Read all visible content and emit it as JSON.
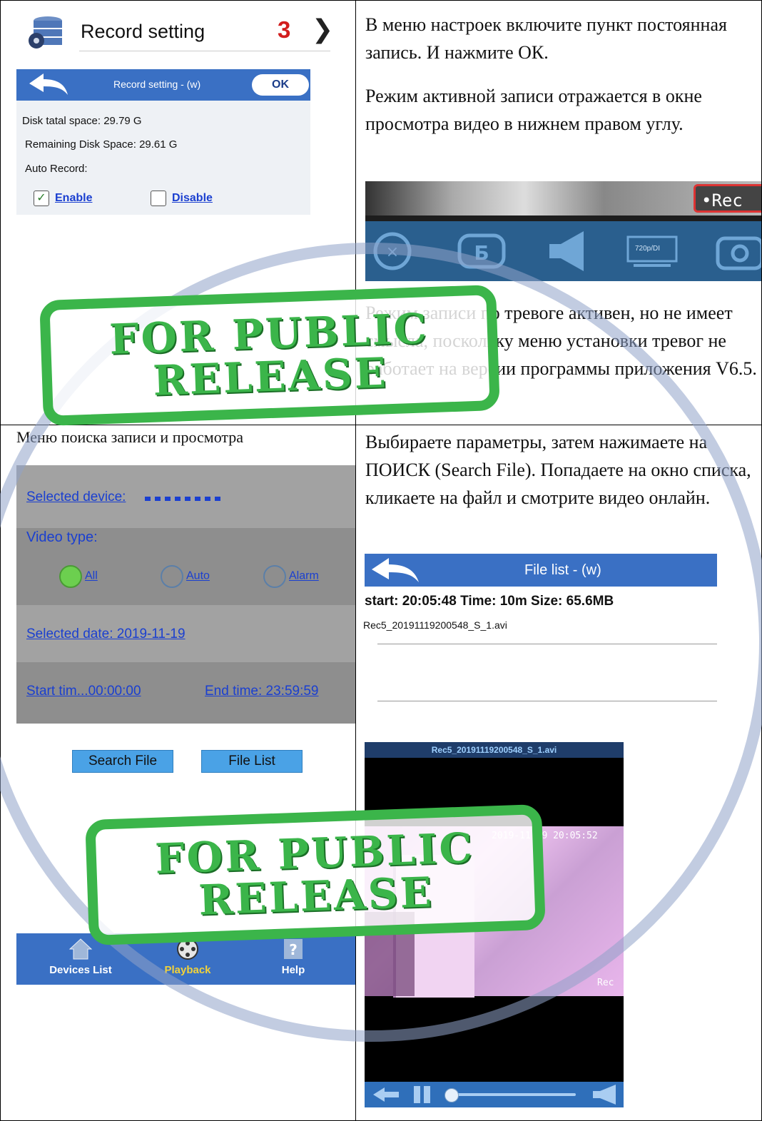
{
  "top_left": {
    "header_title": "Record setting",
    "header_badge": "3",
    "app_bar_title": "Record setting - (w)",
    "ok_label": "OK",
    "disk_total": "Disk  tatal space:  29.79 G",
    "disk_remaining": "Remaining Disk Space:  29.61 G",
    "auto_record": "Auto Record:",
    "enable_label": "Enable",
    "disable_label": "Disable"
  },
  "top_right": {
    "para1": "В меню настроек включите пункт постоянная запись. И нажмите ОК.",
    "para2": "Режим активной записи отражается в окне просмотра видео в нижнем правом углу.",
    "rec_badge": "•Rec",
    "quality_label": "720p/DI",
    "para3": "Режим записи по тревоге активен, но не имеет смысла, поскольку меню установки тревог не работает на версии программы приложения V6.5."
  },
  "bottom_left": {
    "heading": "Меню поиска записи и просмотра",
    "selected_device": "Selected device:  ",
    "video_type": "Video type:",
    "radio_all": "All",
    "radio_auto": "Auto",
    "radio_alarm": "Alarm",
    "selected_date": "Selected date:  2019-11-19",
    "start_time": "Start tim...00:00:00",
    "end_time": "End time:  23:59:59",
    "search_btn": "Search File",
    "filelist_btn": "File List",
    "tab_devices": "Devices List",
    "tab_playback": "Playback",
    "tab_help": "Help"
  },
  "bottom_right": {
    "para": "Выбираете параметры, затем нажимаете на ПОИСК (Search File). Попадаете на окно списка, кликаете на файл и смотрите видео онлайн.",
    "filelist_title": "File list - (w)",
    "file_meta": "start: 20:05:48  Time:  10m  Size:  65.6MB",
    "file_name": "Rec5_20191119200548_S_1.avi",
    "player_title": "Rec5_20191119200548_S_1.avi",
    "video_timestamp": "2019-11-19 20:05:52",
    "video_rec": "Rec"
  },
  "watermark": {
    "line1": "FOR PUBLIC",
    "line2": "RELEASE"
  },
  "colors": {
    "accent_blue": "#3a70c4",
    "stamp_green": "#3bb54a",
    "watermark_ring": "#8fa3c9"
  }
}
